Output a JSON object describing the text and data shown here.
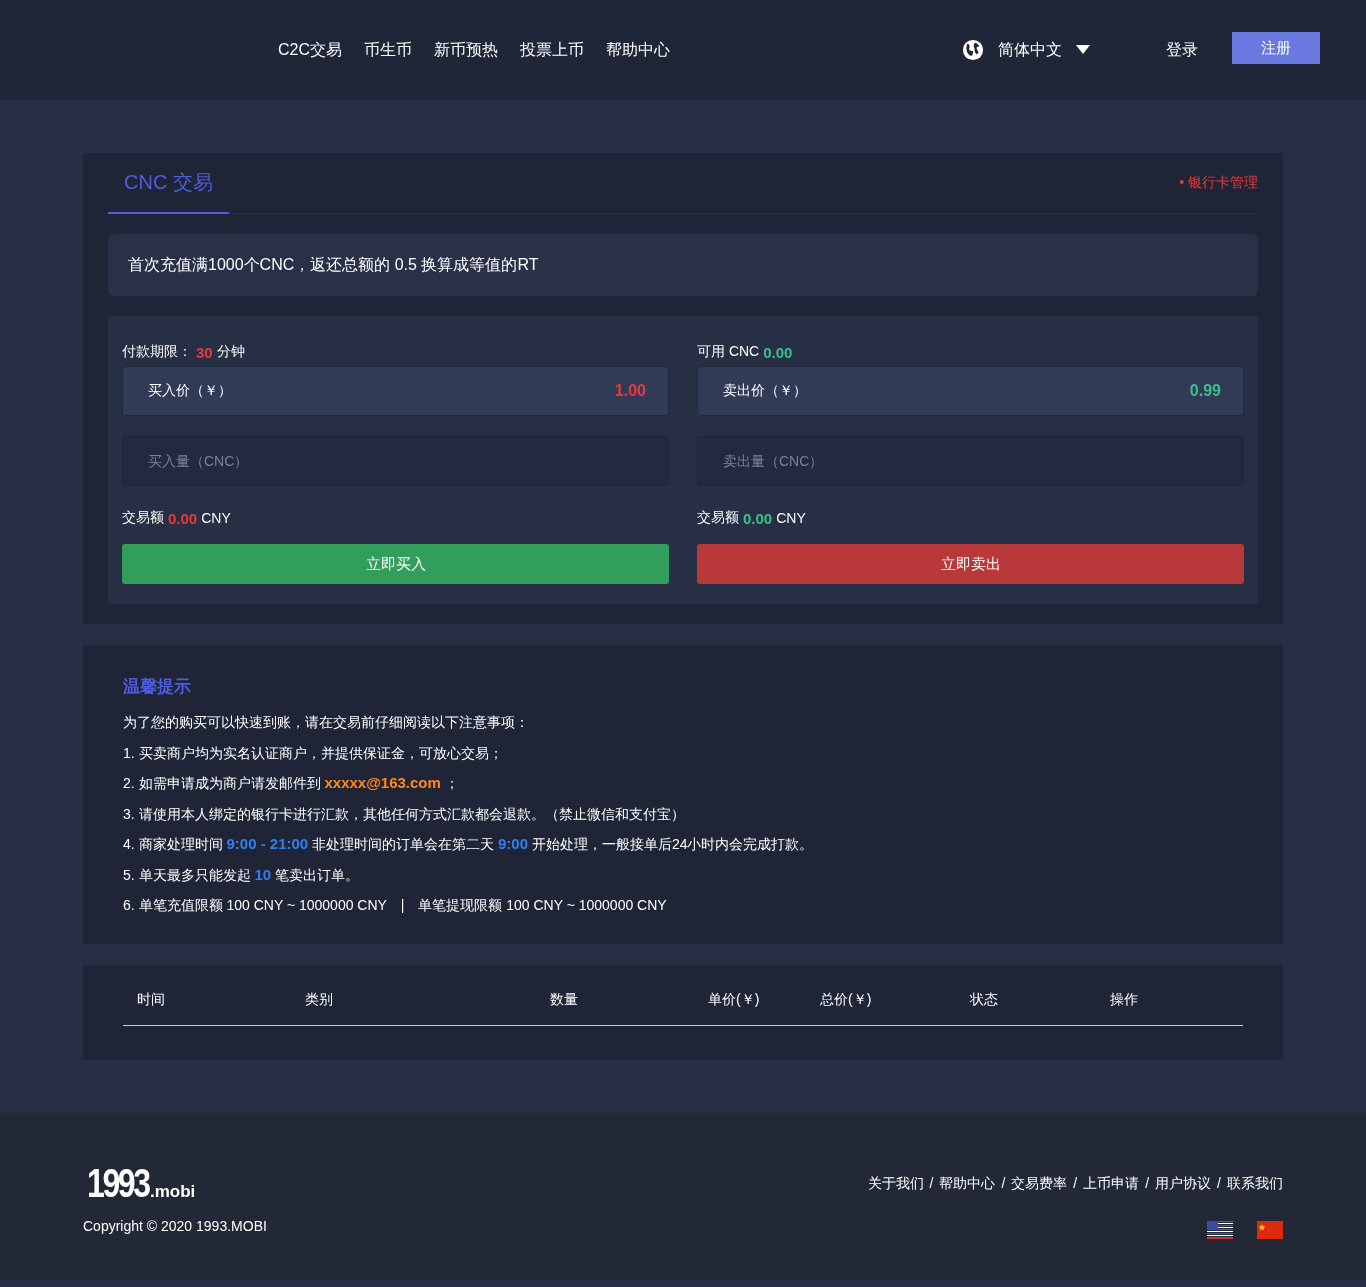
{
  "header": {
    "nav": [
      {
        "label": "C2C交易"
      },
      {
        "label": "币生币"
      },
      {
        "label": "新币预热"
      },
      {
        "label": "投票上币"
      },
      {
        "label": "帮助中心"
      }
    ],
    "language": "简体中文",
    "login": "登录",
    "register": "注册"
  },
  "trade": {
    "tabs": [
      {
        "label": "CNC 交易",
        "selected": true
      }
    ],
    "bank_link": "• 银行卡管理",
    "promo": "首次充值满1000个CNC，返还总额的 0.5 换算成等值的RT",
    "buy": {
      "info_label": "付款期限：",
      "info_value": "30",
      "info_unit": "分钟",
      "price_label": "买入价（￥）",
      "price": "1.00",
      "amount_placeholder": "买入量（CNC）",
      "total_label": "交易额",
      "total": "0.00",
      "total_unit": "CNY",
      "button": "立即买入",
      "kind": "buy"
    },
    "sell": {
      "info_label": "可用 CNC",
      "info_value": "0.00",
      "price_label": "卖出价（￥）",
      "price": "0.99",
      "amount_placeholder": "卖出量（CNC）",
      "total_label": "交易额",
      "total": "0.00",
      "total_unit": "CNY",
      "button": "立即卖出",
      "kind": "sell"
    }
  },
  "tips": {
    "title": "温馨提示",
    "lines": [
      [
        {
          "text": "为了您的购买可以快速到账，请在交易前仔细阅读以下注意事项：",
          "kind": "plain"
        }
      ],
      [
        {
          "text": "1. 买卖商户均为实名认证商户，并提供保证金，可放心交易；",
          "kind": "plain"
        }
      ],
      [
        {
          "text": "2. 如需申请成为商户请发邮件到 ",
          "kind": "plain"
        },
        {
          "text": "xxxxx@163.com",
          "kind": "email"
        },
        {
          "text": " ；",
          "kind": "plain"
        }
      ],
      [
        {
          "text": "3. 请使用本人绑定的银行卡进行汇款，其他任何方式汇款都会退款。（禁止微信和支付宝）",
          "kind": "plain"
        }
      ],
      [
        {
          "text": "4. 商家处理时间 ",
          "kind": "plain"
        },
        {
          "text": "9:00 - 21:00",
          "kind": "number"
        },
        {
          "text": " 非处理时间的订单会在第二天 ",
          "kind": "plain"
        },
        {
          "text": "9:00",
          "kind": "number"
        },
        {
          "text": " 开始处理，一般接单后24小时内会完成打款。",
          "kind": "plain"
        }
      ],
      [
        {
          "text": "5. 单天最多只能发起 ",
          "kind": "plain"
        },
        {
          "text": "10",
          "kind": "number"
        },
        {
          "text": " 笔卖出订单。",
          "kind": "plain"
        }
      ],
      [
        {
          "text": "6. 单笔充值限额 100 CNY ~ 1000000 CNY　|　单笔提现限额 100 CNY ~ 1000000 CNY",
          "kind": "plain"
        }
      ]
    ]
  },
  "table": {
    "columns": [
      "时间",
      "类别",
      "数量",
      "单价(￥)",
      "总价(￥)",
      "状态",
      "操作"
    ]
  },
  "footer": {
    "logo": {
      "main": "1993",
      "suffix": ".mobi"
    },
    "copyright": "Copyright © 2020 1993.MOBI",
    "links": [
      "关于我们",
      "帮助中心",
      "交易费率",
      "上币申请",
      "用户协议",
      "联系我们"
    ],
    "separator": "/"
  }
}
